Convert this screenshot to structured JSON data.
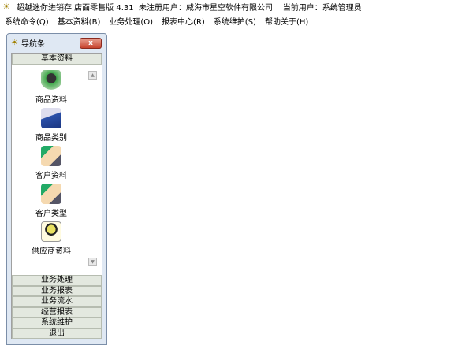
{
  "window": {
    "title": "超越迷你进销存 店面零售版 4.31  未注册用户：威海市星空软件有限公司    当前用户：系统管理员"
  },
  "menu": [
    "系统命令(Q)",
    "基本资料(B)",
    "业务处理(O)",
    "报表中心(R)",
    "系统维护(S)",
    "帮助关于(H)"
  ],
  "nav": {
    "title": "导航条",
    "close": "x",
    "active_section": "基本资料",
    "items": [
      {
        "label": "商品资料",
        "icon": "computer-icon"
      },
      {
        "label": "商品类别",
        "icon": "box-icon"
      },
      {
        "label": "客户资料",
        "icon": "handshake-icon"
      },
      {
        "label": "客户类型",
        "icon": "handshake-icon"
      },
      {
        "label": "供应商资料",
        "icon": "person-icon"
      }
    ],
    "sections": [
      "业务处理",
      "业务报表",
      "业务流水",
      "经营报表",
      "系统维护",
      "退出"
    ]
  }
}
